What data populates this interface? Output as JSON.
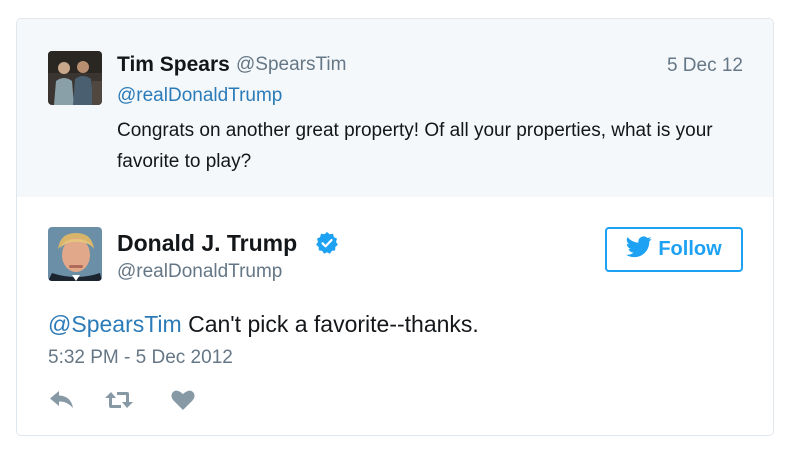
{
  "reply": {
    "name": "Tim Spears",
    "handle": "@SpearsTim",
    "date": "5 Dec 12",
    "mention": "@realDonaldTrump",
    "text": "Congrats on another great property! Of all your properties, what is your favorite to play?"
  },
  "tweet": {
    "name": "Donald J. Trump",
    "handle": "@realDonaldTrump",
    "verified_icon": "verified-badge-icon",
    "follow_label": "Follow",
    "mention": "@SpearsTim",
    "text": " Can't pick a favorite--thanks.",
    "timestamp": "5:32 PM - 5 Dec 2012"
  },
  "actions": {
    "reply_icon": "reply-icon",
    "retweet_icon": "retweet-icon",
    "like_icon": "heart-icon"
  },
  "colors": {
    "accent": "#1da1f2",
    "link": "#2b7bb9",
    "muted": "#657786",
    "text": "#14171a",
    "reply_bg": "#f5f8fa"
  }
}
